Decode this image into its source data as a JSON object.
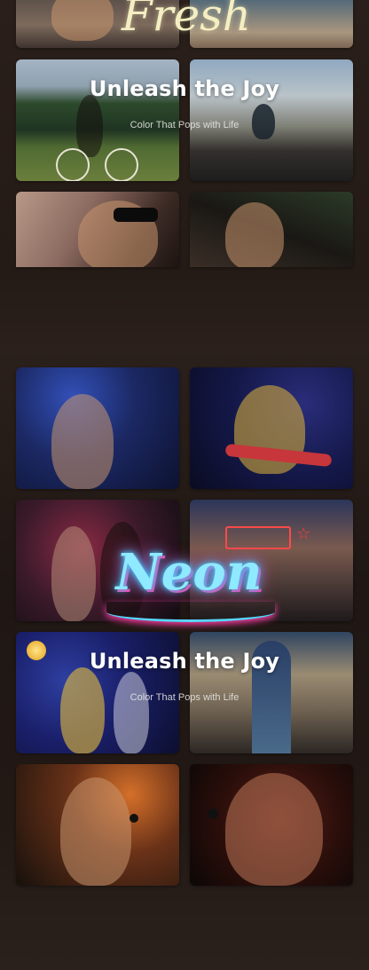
{
  "fresh_section": {
    "script_title": "Fresh",
    "title": "Unleash the Joy",
    "subtitle": "Color That Pops with Life"
  },
  "neon_section": {
    "script_title": "Neon",
    "title": "Unleash the Joy",
    "subtitle": "Color That Pops with Life"
  }
}
